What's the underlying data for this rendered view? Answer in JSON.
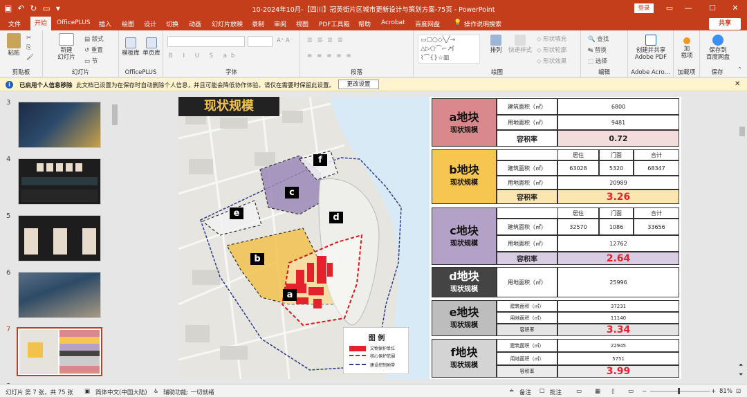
{
  "window": {
    "title": "10-2024年10月-【四川】冠英街片区城市更新设计与策划方案-75页  -  PowerPoint",
    "login": "登录",
    "share": "共享"
  },
  "tabs": [
    "文件",
    "开始",
    "OfficePLUS",
    "插入",
    "绘图",
    "设计",
    "切换",
    "动画",
    "幻灯片放映",
    "录制",
    "审阅",
    "视图",
    "PDF工具箱",
    "帮助",
    "Acrobat",
    "百度网盘",
    "操作说明搜索"
  ],
  "ribbon": {
    "groups": [
      "剪贴板",
      "幻灯片",
      "OfficePLUS",
      "字体",
      "段落",
      "绘图",
      "编辑",
      "Adobe Acro...",
      "加载项",
      "保存"
    ],
    "paste": "粘贴",
    "new_slide": "新建\n幻灯片",
    "layout": "版式",
    "reset": "重置",
    "section": "节",
    "template_lib": "模板库",
    "single_page": "单页库",
    "arrange": "排列",
    "quick_styles": "快速样式",
    "shape_fill": "形状填充",
    "shape_outline": "形状轮廓",
    "shape_effects": "形状效果",
    "find": "查找",
    "replace": "替换",
    "select": "选择",
    "adobe": "创建并共享\nAdobe PDF",
    "addins": "加\n载项",
    "baidu": "保存到\n百度网盘"
  },
  "infobar": {
    "bold": "已启用个人信息移除",
    "message": "此文档已设置为在保存时自动删除个人信息，并且可能会降低协作体验。请仅在需要时保留此设置。",
    "button": "更改设置"
  },
  "thumbnails": [
    "3",
    "4",
    "5",
    "6",
    "7",
    "8"
  ],
  "slide": {
    "title": "现状规模",
    "legend": {
      "title": "图 例",
      "items": [
        "文物保护单位",
        "核心保护范围",
        "建设控制地带"
      ]
    },
    "markers": [
      "a",
      "b",
      "c",
      "d",
      "e",
      "f"
    ]
  },
  "table": {
    "a": {
      "name": "a地块",
      "sub": "现状规模",
      "rows": [
        [
          "建筑面积（㎡）",
          "6800"
        ],
        [
          "用地面积（㎡）",
          "9481"
        ]
      ],
      "far_label": "容积率",
      "far": "0.72"
    },
    "b": {
      "name": "b地块",
      "sub": "现状规模",
      "heads": [
        "居住",
        "门面",
        "合计"
      ],
      "build_label": "建筑面积（㎡）",
      "build": [
        "63028",
        "5320",
        "68347"
      ],
      "land_label": "用地面积（㎡）",
      "land": "20989",
      "far_label": "容积率",
      "far": "3.26"
    },
    "c": {
      "name": "c地块",
      "sub": "现状规模",
      "heads": [
        "居住",
        "门面",
        "合计"
      ],
      "build_label": "建筑面积（㎡）",
      "build": [
        "32570",
        "1086",
        "33656"
      ],
      "land_label": "用地面积（㎡）",
      "land": "12762",
      "far_label": "容积率",
      "far": "2.64"
    },
    "d": {
      "name": "d地块",
      "sub": "现状规模",
      "land_label": "用地面积（㎡）",
      "land": "25996"
    },
    "e": {
      "name": "e地块",
      "sub": "现状规模",
      "rows": [
        [
          "建筑面积（㎡）",
          "37231"
        ],
        [
          "用地面积（㎡）",
          "11140"
        ]
      ],
      "far_label": "容积率",
      "far": "3.34"
    },
    "f": {
      "name": "f地块",
      "sub": "现状规模",
      "rows": [
        [
          "建筑面积（㎡）",
          "22945"
        ],
        [
          "用地面积（㎡）",
          "5751"
        ]
      ],
      "far_label": "容积率",
      "far": "3.99"
    }
  },
  "status": {
    "slide": "幻灯片 第 7 张，共 75 张",
    "lang": "简体中文(中国大陆)",
    "access": "辅助功能: 一切就绪",
    "notes": "备注",
    "comments": "批注",
    "zoom": "81%"
  },
  "colors": {
    "accent": "#c43e1c",
    "a": "#d9898b",
    "b": "#f7c651",
    "c": "#b4a1c7",
    "d": "#444444",
    "e": "#bdbdbd",
    "f": "#d4d4d4",
    "far_red": "#e3222d"
  }
}
